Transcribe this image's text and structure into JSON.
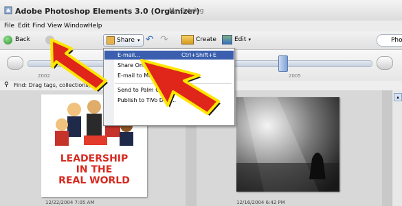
{
  "window": {
    "title": "Adobe Photoshop Elements 3.0 (Organizer)",
    "catalog": "My Catalog"
  },
  "menubar": [
    "File",
    "Edit",
    "Find",
    "View",
    "Window",
    "Help"
  ],
  "toolbar": {
    "back": "Back",
    "share": "Share",
    "create": "Create",
    "edit": "Edit",
    "photo_view": "Pho"
  },
  "timeline": {
    "year_left": "2002",
    "year_right": "2005"
  },
  "findbar": {
    "text": "Find: Drag tags, collections, p"
  },
  "share_menu": {
    "items": [
      {
        "label": "E-mail...",
        "shortcut": "Ctrl+Shift+E"
      },
      {
        "label": "Share Online..."
      },
      {
        "label": "E-mail to Mobile F"
      },
      {
        "label": "Send to Palm OS Ha"
      },
      {
        "label": "Publish to TiVo DVR..."
      }
    ]
  },
  "photos": [
    {
      "date": "12/22/2004 7:05 AM",
      "caption_lines": [
        "LEADERSHIP",
        "IN THE",
        "REAL WORLD"
      ]
    },
    {
      "date": "12/16/2004 6:42 PM"
    }
  ],
  "colors": {
    "menu_highlight": "#3b5fae",
    "arrow_fill": "#e0251b",
    "arrow_outline": "#ffe600"
  }
}
